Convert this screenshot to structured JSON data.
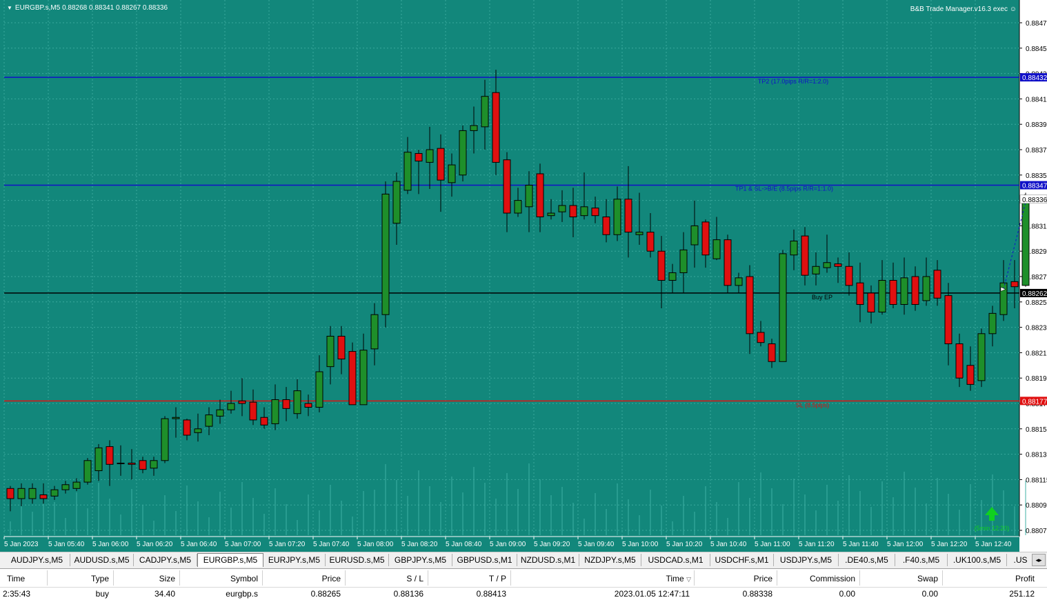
{
  "chart": {
    "header": "EURGBP.s,M5  0.88268 0.88341 0.88267 0.88336",
    "ea_label": "B&B Trade Manager.v16.3 exec",
    "colors": {
      "background": "#12877b",
      "bull": "#1e8f2a",
      "bear": "#e01010",
      "tp_line": "#1010c8",
      "sl_line": "#e01010",
      "entry_line": "#000000",
      "grid": "#3aa99d"
    },
    "price_axis": {
      "min": 0.8807,
      "max": 0.8849,
      "ticks": [
        "0.88475",
        "0.88455",
        "0.88435",
        "0.88415",
        "0.88395",
        "0.88375",
        "0.88355",
        "0.88335",
        "0.88315",
        "0.88295",
        "0.88275",
        "0.88255",
        "0.88235",
        "0.88215",
        "0.88195",
        "0.88175",
        "0.88155",
        "0.88135",
        "0.88115",
        "0.88095",
        "0.88075"
      ]
    },
    "time_labels": [
      "5 Jan 2023",
      "5 Jan 05:40",
      "5 Jan 06:00",
      "5 Jan 06:20",
      "5 Jan 06:40",
      "5 Jan 07:00",
      "5 Jan 07:20",
      "5 Jan 07:40",
      "5 Jan 08:00",
      "5 Jan 08:20",
      "5 Jan 08:40",
      "5 Jan 09:00",
      "5 Jan 09:20",
      "5 Jan 09:40",
      "5 Jan 10:00",
      "5 Jan 10:20",
      "5 Jan 10:40",
      "5 Jan 11:00",
      "5 Jan 11:20",
      "5 Jan 11:40",
      "5 Jan 12:00",
      "5 Jan 12:20",
      "5 Jan 12:40"
    ],
    "levels": [
      {
        "name": "tp2",
        "price": 0.88432,
        "label": "TP2 (17.0pips R/R=1:2.0)",
        "tag": "0.88432",
        "color": "#1010c8"
      },
      {
        "name": "tp1",
        "price": 0.88347,
        "label": "TP1 & SL->B/E (8.5pips R/R=1:1.0)",
        "tag": "0.88347",
        "color": "#1010c8"
      },
      {
        "name": "entry",
        "price": 0.88262,
        "label": "Buy EP",
        "tag": "0.88262",
        "color": "#000000"
      },
      {
        "name": "sl",
        "price": 0.88177,
        "label": "SL (8.5pips)",
        "tag": "0.88177",
        "color": "#e01010"
      }
    ],
    "current_price_tag": "0.88336",
    "signal_text": "(5min 12:20)",
    "candles": [
      [
        0.88108,
        0.881,
        0.8811,
        0.8809
      ],
      [
        0.881,
        0.88108,
        0.88112,
        0.88094
      ],
      [
        0.881,
        0.88108,
        0.88112,
        0.88096
      ],
      [
        0.88103,
        0.881,
        0.88112,
        0.88096
      ],
      [
        0.88102,
        0.88107,
        0.8811,
        0.88099
      ],
      [
        0.88107,
        0.88111,
        0.88114,
        0.88104
      ],
      [
        0.88108,
        0.88113,
        0.88116,
        0.88106
      ],
      [
        0.88113,
        0.8813,
        0.88132,
        0.88111
      ],
      [
        0.88122,
        0.8814,
        0.88143,
        0.88114
      ],
      [
        0.88141,
        0.88127,
        0.88146,
        0.8811
      ],
      [
        0.88128,
        0.88128,
        0.88142,
        0.88118
      ],
      [
        0.88128,
        0.88127,
        0.88139,
        0.88115
      ],
      [
        0.8813,
        0.88123,
        0.88133,
        0.8812
      ],
      [
        0.88124,
        0.8813,
        0.88133,
        0.88118
      ],
      [
        0.8813,
        0.88163,
        0.88165,
        0.88128
      ],
      [
        0.88163,
        0.88164,
        0.88172,
        0.88148
      ],
      [
        0.88162,
        0.8815,
        0.88163,
        0.88146
      ],
      [
        0.88152,
        0.88155,
        0.88167,
        0.88145
      ],
      [
        0.88157,
        0.88166,
        0.88172,
        0.8815
      ],
      [
        0.88165,
        0.8817,
        0.88178,
        0.88159
      ],
      [
        0.8817,
        0.88175,
        0.88185,
        0.88167
      ],
      [
        0.88177,
        0.88175,
        0.88195,
        0.88165
      ],
      [
        0.88176,
        0.88162,
        0.88186,
        0.88158
      ],
      [
        0.88164,
        0.88158,
        0.88172,
        0.88155
      ],
      [
        0.88159,
        0.88178,
        0.8819,
        0.88154
      ],
      [
        0.88178,
        0.88171,
        0.88188,
        0.88161
      ],
      [
        0.88167,
        0.88185,
        0.88194,
        0.88163
      ],
      [
        0.88175,
        0.88172,
        0.88182,
        0.88165
      ],
      [
        0.88172,
        0.882,
        0.88213,
        0.88168
      ],
      [
        0.88204,
        0.88228,
        0.88236,
        0.8819
      ],
      [
        0.88228,
        0.8821,
        0.88236,
        0.88198
      ],
      [
        0.88216,
        0.88174,
        0.88223,
        0.88174
      ],
      [
        0.88174,
        0.88217,
        0.8823,
        0.88174
      ],
      [
        0.88218,
        0.88245,
        0.88254,
        0.88205
      ],
      [
        0.88245,
        0.8834,
        0.8835,
        0.88235
      ],
      [
        0.88317,
        0.8835,
        0.88357,
        0.883
      ],
      [
        0.88343,
        0.88373,
        0.88385,
        0.8834
      ],
      [
        0.88372,
        0.88366,
        0.88375,
        0.8834
      ],
      [
        0.88365,
        0.88375,
        0.88393,
        0.88344
      ],
      [
        0.88376,
        0.88351,
        0.88387,
        0.88326
      ],
      [
        0.88349,
        0.88363,
        0.88372,
        0.88338
      ],
      [
        0.88355,
        0.8839,
        0.88394,
        0.8835
      ],
      [
        0.8839,
        0.88394,
        0.88409,
        0.88372
      ],
      [
        0.88393,
        0.88417,
        0.8843,
        0.88375
      ],
      [
        0.8842,
        0.88365,
        0.88438,
        0.88355
      ],
      [
        0.88367,
        0.88325,
        0.88373,
        0.8831
      ],
      [
        0.88325,
        0.88335,
        0.88345,
        0.88322
      ],
      [
        0.8833,
        0.88347,
        0.88358,
        0.8831
      ],
      [
        0.88356,
        0.88322,
        0.88364,
        0.8831
      ],
      [
        0.88323,
        0.88325,
        0.88336,
        0.8832
      ],
      [
        0.88326,
        0.88331,
        0.88343,
        0.88318
      ],
      [
        0.88331,
        0.88322,
        0.88345,
        0.88306
      ],
      [
        0.88323,
        0.8833,
        0.88357,
        0.8832
      ],
      [
        0.88329,
        0.88323,
        0.88338,
        0.88317
      ],
      [
        0.88322,
        0.88308,
        0.88336,
        0.88302
      ],
      [
        0.88308,
        0.88336,
        0.88346,
        0.88303
      ],
      [
        0.88336,
        0.8831,
        0.88362,
        0.8829
      ],
      [
        0.88308,
        0.8831,
        0.88341,
        0.883
      ],
      [
        0.8831,
        0.88295,
        0.88325,
        0.8829
      ],
      [
        0.88295,
        0.88272,
        0.88307,
        0.8825
      ],
      [
        0.88272,
        0.88278,
        0.88285,
        0.88262
      ],
      [
        0.88278,
        0.88296,
        0.8831,
        0.88262
      ],
      [
        0.883,
        0.88315,
        0.88335,
        0.88282
      ],
      [
        0.88318,
        0.88292,
        0.8832,
        0.88282
      ],
      [
        0.88289,
        0.88304,
        0.88322,
        0.88288
      ],
      [
        0.88304,
        0.88268,
        0.88308,
        0.88262
      ],
      [
        0.88268,
        0.88274,
        0.88278,
        0.88262
      ],
      [
        0.88275,
        0.8823,
        0.88284,
        0.88214
      ],
      [
        0.88231,
        0.88223,
        0.8824,
        0.8822
      ],
      [
        0.88222,
        0.88208,
        0.88226,
        0.88203
      ],
      [
        0.88208,
        0.88293,
        0.88296,
        0.88208
      ],
      [
        0.88292,
        0.88303,
        0.88312,
        0.8828
      ],
      [
        0.88307,
        0.88276,
        0.88314,
        0.88268
      ],
      [
        0.88277,
        0.88283,
        0.88294,
        0.88268
      ],
      [
        0.88282,
        0.88286,
        0.88308,
        0.88278
      ],
      [
        0.88285,
        0.88283,
        0.8829,
        0.8827
      ],
      [
        0.88283,
        0.88268,
        0.88294,
        0.8826
      ],
      [
        0.8827,
        0.88253,
        0.88286,
        0.88239
      ],
      [
        0.88262,
        0.88247,
        0.88268,
        0.88238
      ],
      [
        0.88247,
        0.88272,
        0.88288,
        0.88245
      ],
      [
        0.88272,
        0.88253,
        0.88286,
        0.8825
      ],
      [
        0.88253,
        0.88274,
        0.8829,
        0.88245
      ],
      [
        0.88275,
        0.88253,
        0.88283,
        0.88248
      ],
      [
        0.88256,
        0.88275,
        0.8829,
        0.88252
      ],
      [
        0.8828,
        0.88258,
        0.88288,
        0.88252
      ],
      [
        0.8826,
        0.88222,
        0.8827,
        0.88205
      ],
      [
        0.88222,
        0.88195,
        0.8823,
        0.88188
      ],
      [
        0.88205,
        0.8819,
        0.8822,
        0.88185
      ],
      [
        0.88193,
        0.8823,
        0.88234,
        0.88188
      ],
      [
        0.8823,
        0.88246,
        0.88252,
        0.8822
      ],
      [
        0.88245,
        0.8827,
        0.88288,
        0.8824
      ],
      [
        0.88271,
        0.88267,
        0.88288,
        0.8825
      ],
      [
        0.88268,
        0.88336,
        0.88341,
        0.88267
      ]
    ]
  },
  "tabs": [
    {
      "label": "AUDJPY.s,M5",
      "active": false
    },
    {
      "label": "AUDUSD.s,M5",
      "active": false
    },
    {
      "label": "CADJPY.s,M5",
      "active": false
    },
    {
      "label": "EURGBP.s,M5",
      "active": true
    },
    {
      "label": "EURJPY.s,M5",
      "active": false
    },
    {
      "label": "EURUSD.s,M5",
      "active": false
    },
    {
      "label": "GBPJPY.s,M5",
      "active": false
    },
    {
      "label": "GBPUSD.s,M1",
      "active": false
    },
    {
      "label": "NZDUSD.s,M1",
      "active": false
    },
    {
      "label": "NZDJPY.s,M5",
      "active": false
    },
    {
      "label": "USDCAD.s,M1",
      "active": false
    },
    {
      "label": "USDCHF.s,M1",
      "active": false
    },
    {
      "label": "USDJPY.s,M5",
      "active": false
    },
    {
      "label": ".DE40.s,M5",
      "active": false
    },
    {
      "label": ".F40.s,M5",
      "active": false
    },
    {
      "label": ".UK100.s,M5",
      "active": false
    },
    {
      "label": ".US",
      "active": false
    }
  ],
  "trade_table": {
    "headers": {
      "time": "Time",
      "type": "Type",
      "size": "Size",
      "symbol": "Symbol",
      "price": "Price",
      "sl": "S / L",
      "tp": "T / P",
      "close_time": "Time",
      "close_price": "Price",
      "commission": "Commission",
      "swap": "Swap",
      "profit": "Profit"
    },
    "row": {
      "time": "2:35:43",
      "type": "buy",
      "size": "34.40",
      "symbol": "eurgbp.s",
      "price": "0.88265",
      "sl": "0.88136",
      "tp": "0.88413",
      "close_time": "2023.01.05 12:47:11",
      "close_price": "0.88338",
      "commission": "0.00",
      "swap": "0.00",
      "profit": "251.12"
    }
  }
}
